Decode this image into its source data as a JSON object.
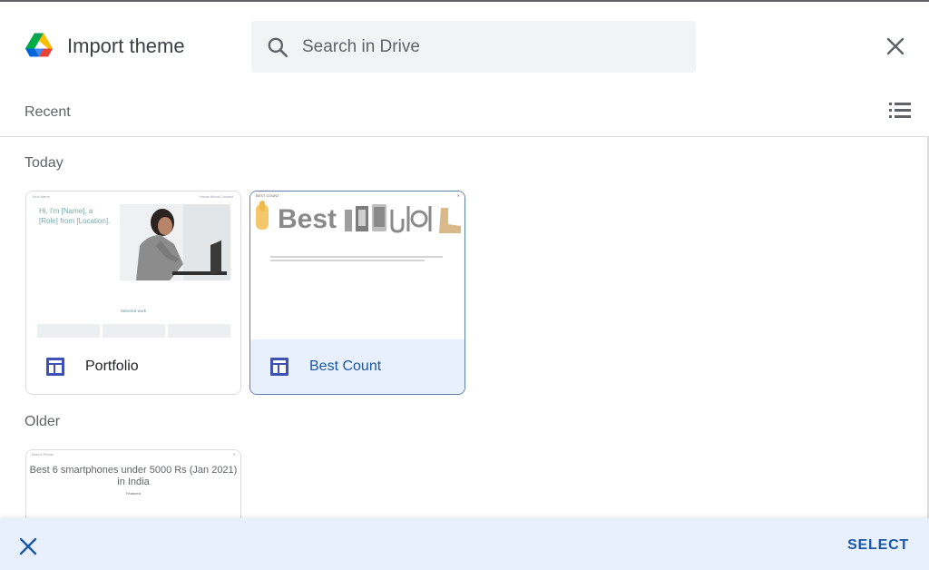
{
  "header": {
    "title": "Import theme",
    "logo_icon": "google-drive-icon",
    "search_placeholder": "Search in Drive"
  },
  "recent_bar": {
    "label": "Recent",
    "view_icon": "list-view-icon"
  },
  "sections": {
    "today": "Today",
    "older": "Older"
  },
  "files": {
    "portfolio": {
      "name": "Portfolio",
      "icon": "site-template-icon",
      "thumb_header": "Your Name",
      "thumb_nav": "Home   About   Contact",
      "thumb_greeting": "Hi, I'm [Name], a [Role] from [Location].",
      "thumb_selected_work": "Selected work"
    },
    "best_count": {
      "name": "Best Count",
      "icon": "site-template-icon",
      "selected": true,
      "thumb_header": "BEST COUNT",
      "thumb_logo": "Best"
    },
    "older_file": {
      "thumb_header": "Best 6 Phone",
      "thumb_title": "Best 6 smartphones under 5000 Rs (Jan 2021) in India",
      "thumb_sub": "Featured"
    }
  },
  "footer": {
    "select_label": "SELECT",
    "cancel_icon": "close-icon"
  },
  "colors": {
    "accent": "#1a56a8",
    "selected_bg": "#e8f0fe",
    "text_secondary": "#5f6368",
    "search_bg": "#f1f3f4"
  }
}
